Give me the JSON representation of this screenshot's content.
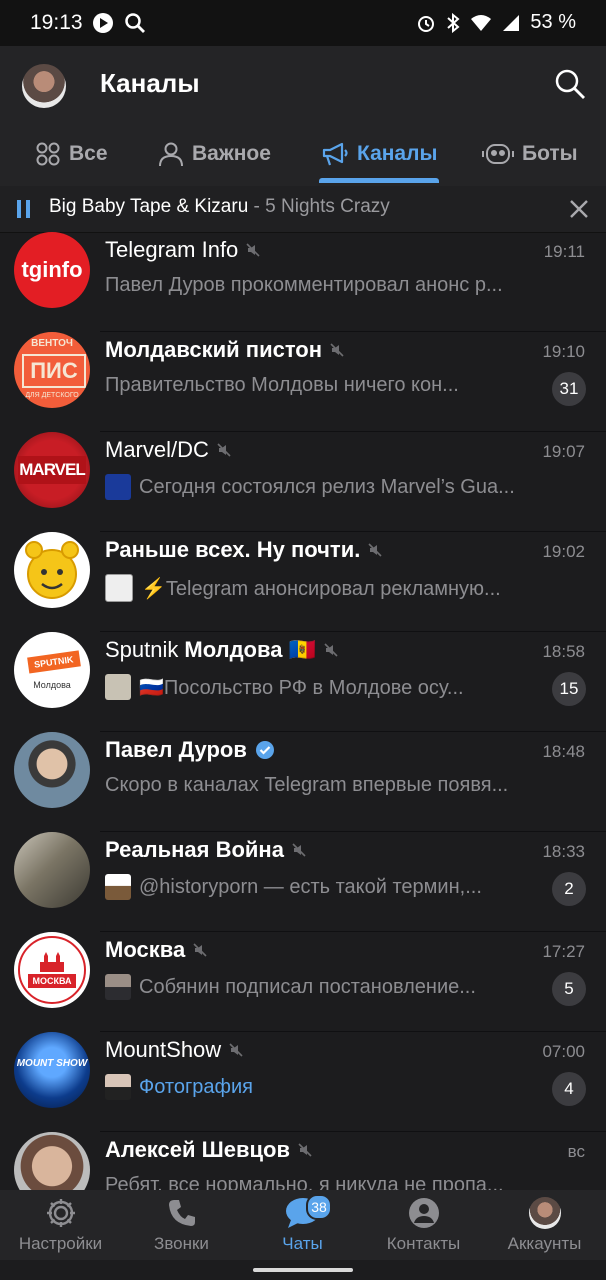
{
  "status_bar": {
    "time": "19:13",
    "battery": "53 %"
  },
  "header": {
    "title": "Каналы"
  },
  "tabs": [
    {
      "label": "Все",
      "icon": "grid-icon"
    },
    {
      "label": "Важное",
      "icon": "person-icon"
    },
    {
      "label": "Каналы",
      "icon": "megaphone-icon",
      "active": true
    },
    {
      "label": "Боты",
      "icon": "bot-icon"
    }
  ],
  "player": {
    "title": "Big Baby Tape & Kizaru",
    "separator": " - ",
    "track": "5 Nights Crazy"
  },
  "chats": [
    {
      "name": "Telegram Info",
      "bold": false,
      "time": "19:11",
      "message": "Павел Дуров прокомментировал анонс р...",
      "badge": ""
    },
    {
      "name": "Молдавский пистон",
      "bold": true,
      "time": "19:10",
      "message": "Правительство Молдовы ничего кон...",
      "badge": "31"
    },
    {
      "name": "Marvel/DC",
      "bold": false,
      "time": "19:07",
      "message": "Сегодня состоялся релиз Marvel’s Gua...",
      "badge": ""
    },
    {
      "name": "Раньше всех. Ну почти.",
      "bold": true,
      "time": "19:02",
      "message": "⚡Telegram анонсировал рекламную...",
      "badge": ""
    },
    {
      "name_prefix": "Sputnik",
      "name": "Молдова 🇲🇩",
      "bold": true,
      "time": "18:58",
      "message": "🇷🇺Посольство РФ в Молдове осу...",
      "badge": "15"
    },
    {
      "name": "Павел Дуров",
      "bold": true,
      "verified": true,
      "time": "18:48",
      "message": "Скоро в каналах Telegram впервые появя...",
      "badge": ""
    },
    {
      "name": "Реальная Война",
      "bold": true,
      "time": "18:33",
      "message": "@historyporn — есть такой термин,...",
      "badge": "2"
    },
    {
      "name": "Москва",
      "bold": true,
      "time": "17:27",
      "message": "Собянин подписал постановление...",
      "badge": "5"
    },
    {
      "name": "MountShow",
      "bold": false,
      "time": "07:00",
      "message": "Фотография",
      "badge": "4"
    },
    {
      "name": "Алексей Шевцов",
      "bold": true,
      "time": "вс",
      "message": "Ребят, все нормально, я никуда не пропа...",
      "badge": ""
    }
  ],
  "avatar_texts": {
    "tginfo": "tginfo",
    "marvel": "MARVEL",
    "pistonTop": "ВЕНТОЧ",
    "piston": "ПИС",
    "pistonBottom": "ДЛЯ ДЕТСКОГО",
    "sputnik": "SPUTNIK",
    "sputnikSub": "Молдова",
    "moscow": "МОСКВА",
    "mountshow": "MOUNT SHOW"
  },
  "bottom_nav": [
    {
      "label": "Настройки",
      "icon": "gear-icon"
    },
    {
      "label": "Звонки",
      "icon": "phone-icon"
    },
    {
      "label": "Чаты",
      "icon": "chat-icon",
      "active": true,
      "badge": "38"
    },
    {
      "label": "Контакты",
      "icon": "contact-icon"
    },
    {
      "label": "Аккаунты",
      "icon": "account-avatar"
    }
  ],
  "colors": {
    "accent": "#5aa4eb",
    "background": "#1c1c1e",
    "header": "#242426",
    "badge": "#3c3c40"
  }
}
